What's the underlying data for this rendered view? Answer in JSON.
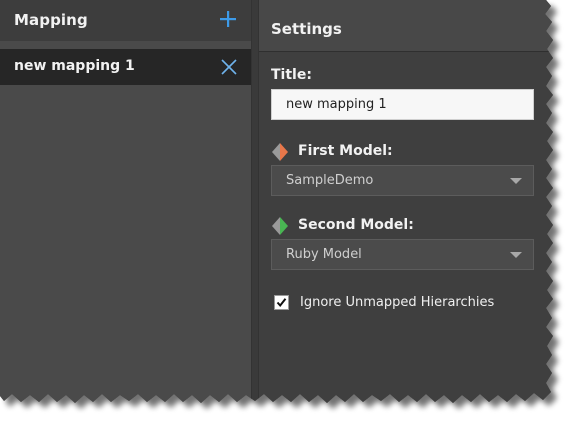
{
  "left_panel": {
    "title": "Mapping",
    "add_icon": "plus-icon",
    "items": [
      {
        "label": "new mapping 1",
        "icon": "close-icon"
      }
    ]
  },
  "settings": {
    "title": "Settings",
    "title_field": {
      "label": "Title:",
      "value": "new mapping 1"
    },
    "first_model": {
      "label": "First Model:",
      "value": "SampleDemo",
      "icon": "model-icon-orange"
    },
    "second_model": {
      "label": "Second Model:",
      "value": "Ruby Model",
      "icon": "model-icon-green"
    },
    "ignore_unmapped": {
      "label": "Ignore Unmapped Hierarchies",
      "checked": true
    }
  },
  "colors": {
    "accent_blue": "#3d9be9",
    "first_model_orange": "#e8774a",
    "second_model_green": "#49b553"
  }
}
